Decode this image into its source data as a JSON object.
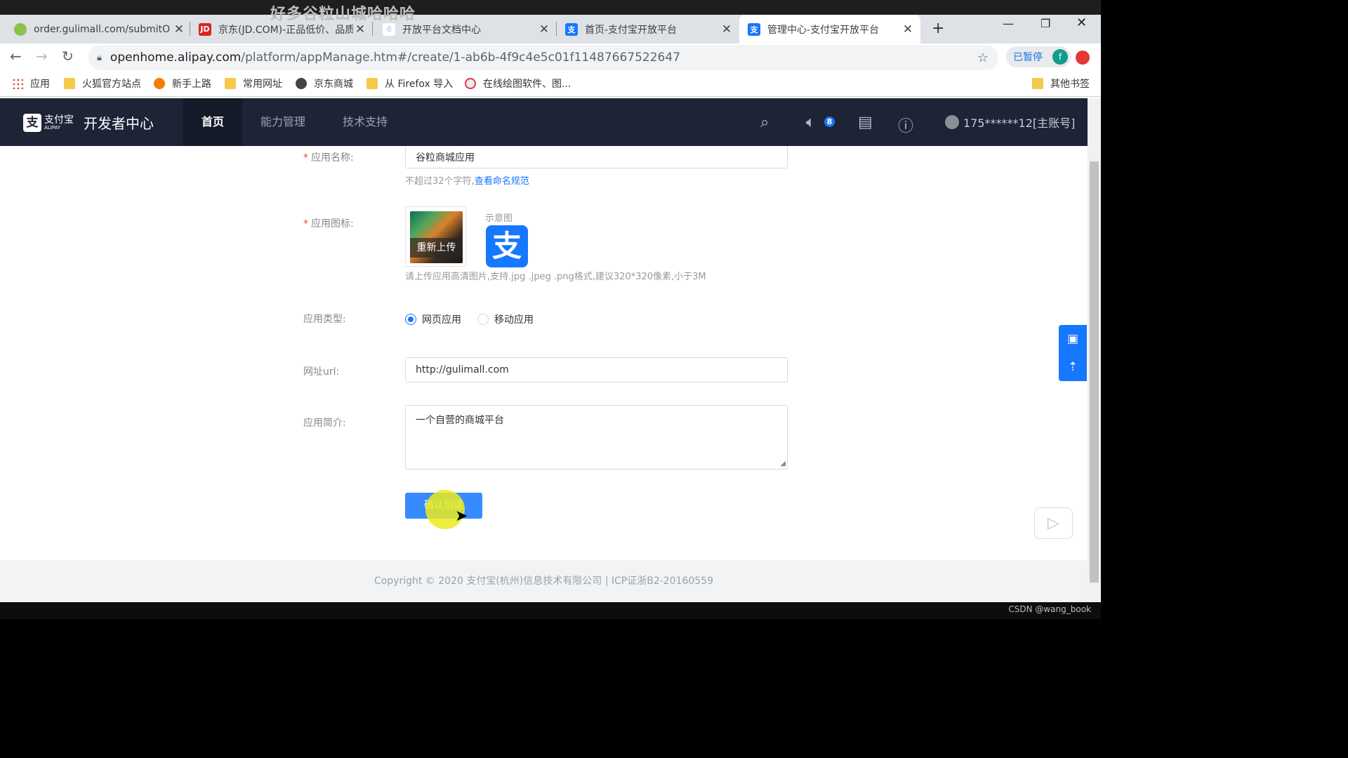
{
  "overlay_title": "好多谷粒山城哈哈哈",
  "browser": {
    "tabs": [
      {
        "title": "order.gulimall.com/submitO",
        "favicon": "leaf-icon"
      },
      {
        "title": "京东(JD.COM)-正品低价、品质",
        "favicon": "jd-icon",
        "favicon_text": "JD"
      },
      {
        "title": "开放平台文档中心",
        "favicon": "doc-person-icon"
      },
      {
        "title": "首页-支付宝开放平台",
        "favicon": "alipay-icon",
        "favicon_text": "支"
      },
      {
        "title": "管理中心-支付宝开放平台",
        "favicon": "alipay-icon",
        "favicon_text": "支"
      }
    ],
    "url_host": "openhome.alipay.com",
    "url_path": "/platform/appManage.htm#/create/1-ab6b-4f9c4e5c01f11487667522647",
    "paused_label": "已暂停",
    "profile_initial": "f",
    "bookmarks": [
      {
        "label": "应用",
        "icon": "apps-grid-icon"
      },
      {
        "label": "火狐官方站点",
        "icon": "folder-icon"
      },
      {
        "label": "新手上路",
        "icon": "firefox-icon"
      },
      {
        "label": "常用网址",
        "icon": "folder-icon"
      },
      {
        "label": "京东商城",
        "icon": "globe-icon"
      },
      {
        "label": "从 Firefox 导入",
        "icon": "folder-icon"
      },
      {
        "label": "在线绘图软件、图...",
        "icon": "draw-icon"
      },
      {
        "label": "其他书签",
        "icon": "folder-icon"
      }
    ]
  },
  "header": {
    "brand_logo": "支",
    "brand_cn": "支付宝",
    "brand_en": "ALIPAY",
    "brand_title": "开发者中心",
    "nav": [
      "首页",
      "能力管理",
      "技术支持"
    ],
    "notice_count": "8",
    "user": "175******12[主账号]"
  },
  "form": {
    "name_label": "应用名称:",
    "name_value": "谷粒商城应用",
    "name_hint": "不超过32个字符,",
    "name_hint_link": "查看命名规范",
    "icon_label": "应用图标:",
    "reupload": "重新上传",
    "sample_label": "示意图",
    "sample_logo": "支",
    "icon_hint": "请上传应用高清图片,支持.jpg .jpeg .png格式,建议320*320像素,小于3M",
    "type_label": "应用类型:",
    "type_options": [
      "网页应用",
      "移动应用"
    ],
    "url_label": "网址url:",
    "url_value": "http://gulimall.com",
    "desc_label": "应用简介:",
    "desc_value": "一个自营的商城平台",
    "submit": "确认创建"
  },
  "footer": "Copyright © 2020 支付宝(杭州)信息技术有限公司 | ICP证浙B2-20160559",
  "watermark": "CSDN @wang_book",
  "colors": {
    "accent": "#1677ff",
    "header_bg": "#1c2436",
    "required": "#f04134"
  }
}
